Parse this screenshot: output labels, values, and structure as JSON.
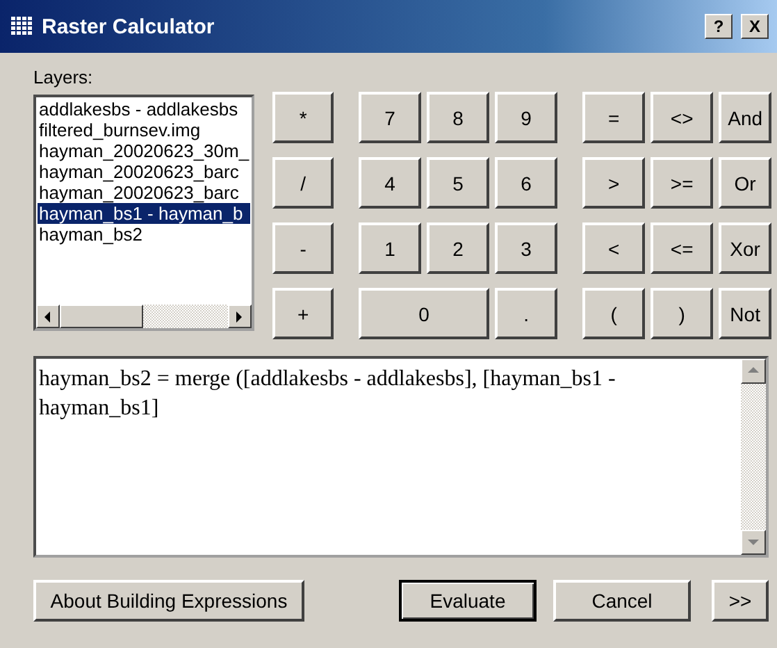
{
  "window": {
    "title": "Raster Calculator",
    "buttons": [
      "?",
      "X"
    ]
  },
  "layers": {
    "label": "Layers:",
    "items": [
      {
        "name": "addlakesbs - addlakesbs",
        "selected": false
      },
      {
        "name": "filtered_burnsev.img",
        "selected": false
      },
      {
        "name": "hayman_20020623_30m_",
        "selected": false
      },
      {
        "name": "hayman_20020623_barc",
        "selected": false
      },
      {
        "name": "hayman_20020623_barc",
        "selected": false
      },
      {
        "name": "hayman_bs1 - hayman_b",
        "selected": true
      },
      {
        "name": "hayman_bs2",
        "selected": false
      }
    ]
  },
  "keypad": [
    [
      {
        "label": "*",
        "kind": "key"
      },
      {
        "label": "7",
        "kind": "key"
      },
      {
        "label": "8",
        "kind": "key"
      },
      {
        "label": "9",
        "kind": "key"
      },
      {
        "label": "=",
        "kind": "key"
      },
      {
        "label": "<>",
        "kind": "key"
      },
      {
        "label": "And",
        "kind": "key"
      }
    ],
    [
      {
        "label": "/",
        "kind": "key"
      },
      {
        "label": "4",
        "kind": "key"
      },
      {
        "label": "5",
        "kind": "key"
      },
      {
        "label": "6",
        "kind": "key"
      },
      {
        "label": ">",
        "kind": "key"
      },
      {
        "label": ">=",
        "kind": "key"
      },
      {
        "label": "Or",
        "kind": "key"
      }
    ],
    [
      {
        "label": "-",
        "kind": "key"
      },
      {
        "label": "1",
        "kind": "key"
      },
      {
        "label": "2",
        "kind": "key"
      },
      {
        "label": "3",
        "kind": "key"
      },
      {
        "label": "<",
        "kind": "key"
      },
      {
        "label": "<=",
        "kind": "key"
      },
      {
        "label": "Xor",
        "kind": "key"
      }
    ],
    [
      {
        "label": "+",
        "kind": "key"
      },
      {
        "label": "0",
        "kind": "wide"
      },
      {
        "label": ".",
        "kind": "key"
      },
      {
        "label": "(",
        "kind": "key"
      },
      {
        "label": ")",
        "kind": "key"
      },
      {
        "label": "Not",
        "kind": "key"
      }
    ]
  ],
  "expression": "hayman_bs2 = merge ([addlakesbs - addlakesbs], [hayman_bs1 - hayman_bs1]",
  "buttons": [
    {
      "label": "About Building Expressions",
      "default": false
    },
    {
      "label": "Evaluate",
      "default": true
    },
    {
      "label": "Cancel",
      "default": false
    },
    {
      "label": ">>",
      "default": false
    }
  ]
}
